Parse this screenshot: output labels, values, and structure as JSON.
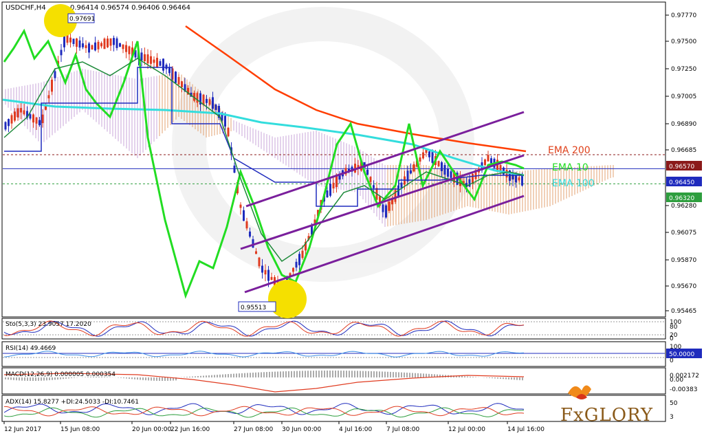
{
  "chart_data": {
    "type": "line",
    "symbol_header": "USDCHF,H4",
    "ohlc_header": "0.96414 0.96574 0.96406 0.96464",
    "price_axis_ticks": [
      "0.97770",
      "0.97500",
      "0.97250",
      "0.97005",
      "0.96890",
      "0.96685",
      "0.96570",
      "0.96450",
      "0.96320",
      "0.96280",
      "0.96075",
      "0.95870",
      "0.95670",
      "0.95465"
    ],
    "price_tags": [
      {
        "value": "0.96570",
        "color": "#8b1a1a"
      },
      {
        "value": "0.96450",
        "color": "#1f2bbd"
      },
      {
        "value": "0.96320",
        "color": "#2e9e3e"
      }
    ],
    "time_axis_labels": [
      "12 Jun 2017",
      "15 Jun 08:00",
      "20 Jun 00:00",
      "22 Jun 16:00",
      "27 Jun 08:00",
      "30 Jun 00:00",
      "4 Jul 16:00",
      "7 Jul 08:00",
      "12 Jul 00:00",
      "14 Jul 16:00"
    ],
    "annotations": {
      "high_label": "0.97691",
      "low_label": "0.95513",
      "ema200_label": "EMA 200",
      "ema10_label": "EMA 10",
      "ema100_label": "EMA 100"
    },
    "colors": {
      "ema200": "#ff3d00",
      "ema10": "#22dd22",
      "ema100": "#33dddd",
      "kijun": "#1f2bbd",
      "tenkan": "#1e8a3a",
      "channel": "#7a1f9c",
      "cloud_bull": "#e3a070",
      "cloud_bear": "#c8a6d8",
      "candle_up": "#1f2bbd",
      "candle_down": "#e03b20"
    },
    "indicators": [
      {
        "title": "Sto(5,3,3) 23.9057 17.2020",
        "ticks": [
          "100",
          "80",
          "20",
          "0"
        ]
      },
      {
        "title": "RSI(14) 49.4669",
        "ticks": [
          "100",
          "50.0000",
          "0"
        ]
      },
      {
        "title": "MACD(12,26,9) 0.000005 0.000354",
        "ticks": [
          "0.002172",
          "0.00",
          "-0.00383"
        ]
      },
      {
        "title": "ADX(14) 15.8277 +DI:24.5033 -DI:10.7461",
        "ticks": [
          "50",
          "3"
        ]
      }
    ]
  },
  "brand": {
    "name": "FxGLORY"
  }
}
